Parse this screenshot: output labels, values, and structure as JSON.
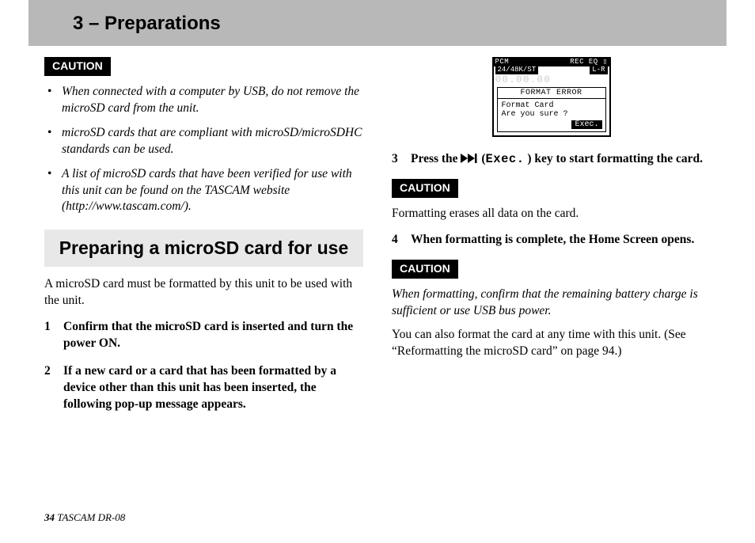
{
  "header": {
    "title": "3 – Preparations"
  },
  "left": {
    "caution": "CAUTION",
    "bullets": [
      "When connected with a computer by USB, do not remove the microSD card from the unit.",
      "microSD cards that are compliant with microSD/microSDHC standards can be used.",
      "A list of microSD cards that have been verified for use with this unit can be found on the TASCAM website (http://www.tascam.com/)."
    ],
    "section": "Preparing a microSD card for use",
    "intro": "A microSD card must be formatted by this unit to be used with the unit.",
    "step1_num": "1",
    "step1": "Confirm that the microSD card is inserted and turn the power ON.",
    "step2_num": "2",
    "step2": "If a new card or a card that has been formatted by a device other than this unit has been inserted, the following pop-up message appears."
  },
  "right": {
    "screen": {
      "top_left": "PCM",
      "top_right": "REC EQ ▯",
      "sub_left": "24/48K/ST",
      "sub_right": "L-R",
      "digits": "00.00.00",
      "popup_title": "FORMAT ERROR",
      "popup_line1": "Format Card",
      "popup_line2": "Are you sure ?",
      "exec": "Exec."
    },
    "step3_num": "3",
    "step3_a": "Press the ",
    "step3_exec": "Exec.",
    "step3_b": ") key to start formatting the card.",
    "caution1": "CAUTION",
    "caution1_text": "Formatting erases all data on the card.",
    "step4_num": "4",
    "step4": "When formatting is complete, the Home Screen opens.",
    "caution2": "CAUTION",
    "caution2_text": "When formatting, confirm that the remaining battery charge is sufficient or use USB bus power.",
    "closing": "You can also format the card at any time with this unit. (See “Reformatting the microSD card” on page 94.)"
  },
  "footer": {
    "page": "34",
    "model": " TASCAM  DR-08"
  }
}
